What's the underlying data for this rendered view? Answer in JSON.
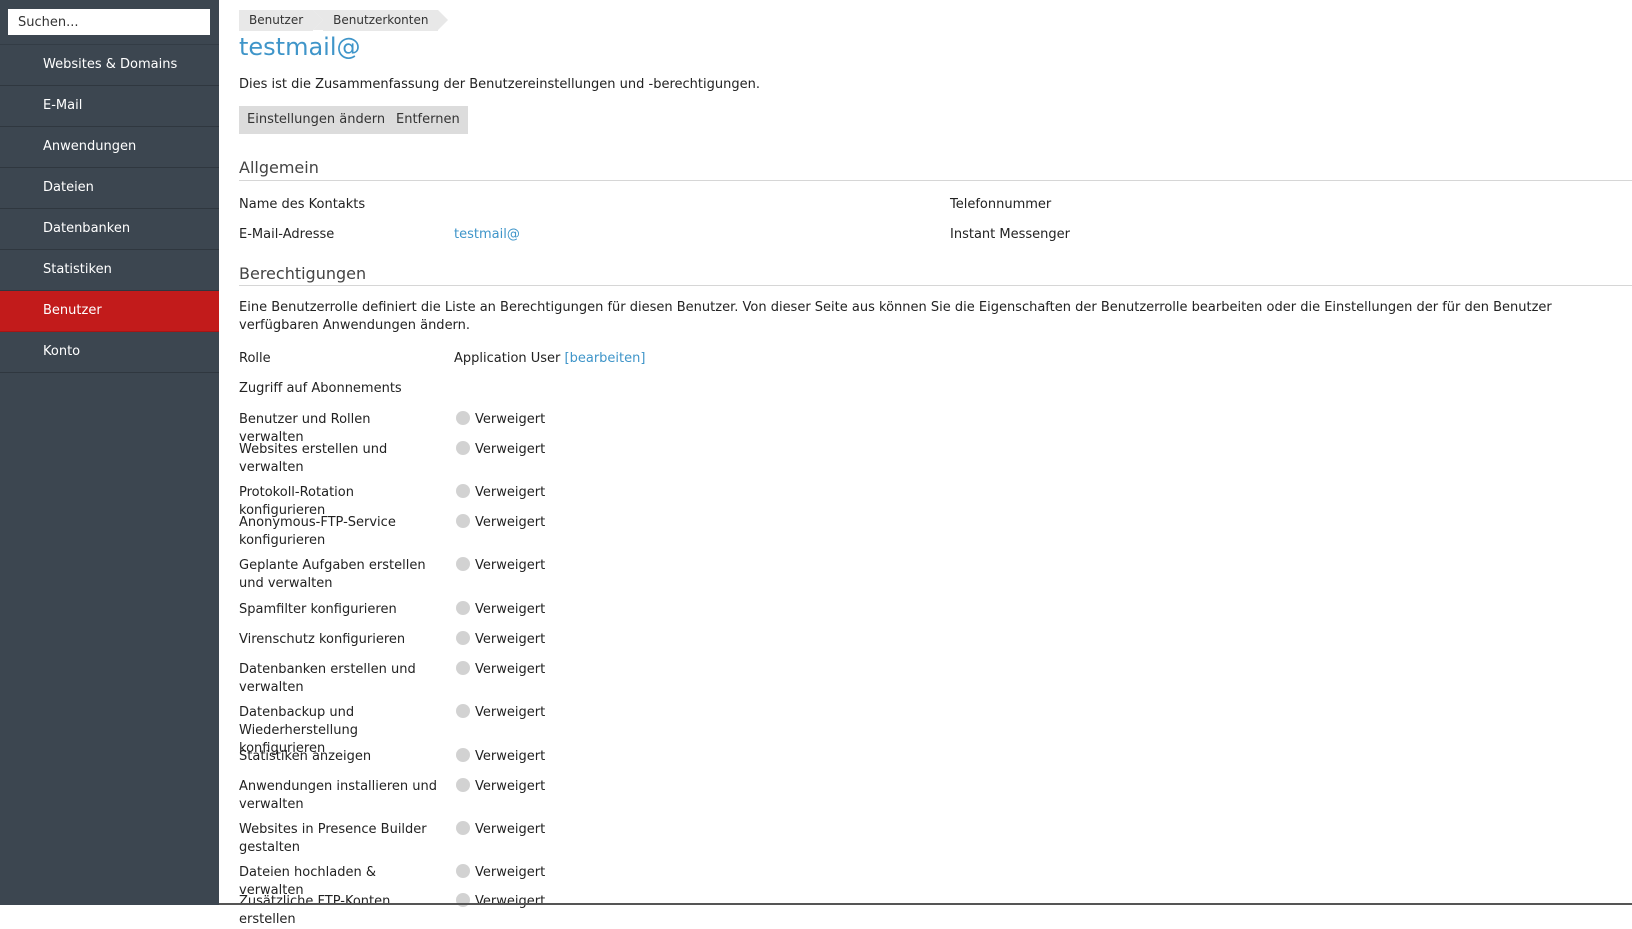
{
  "search": {
    "placeholder": "Suchen..."
  },
  "sidebar": {
    "items": [
      {
        "label": "Websites & Domains"
      },
      {
        "label": "E-Mail"
      },
      {
        "label": "Anwendungen"
      },
      {
        "label": "Dateien"
      },
      {
        "label": "Datenbanken"
      },
      {
        "label": "Statistiken"
      },
      {
        "label": "Benutzer",
        "active": true
      },
      {
        "label": "Konto"
      }
    ]
  },
  "breadcrumb": [
    "Benutzer",
    "Benutzerkonten"
  ],
  "page": {
    "title": "testmail@",
    "intro": "Dies ist die Zusammenfassung der Benutzereinstellungen und -berechtigungen.",
    "buttons": {
      "edit": "Einstellungen ändern",
      "remove": "Entfernen"
    }
  },
  "general": {
    "heading": "Allgemein",
    "contact_name_label": "Name des Kontakts",
    "phone_label": "Telefonnummer",
    "email_label": "E-Mail-Adresse",
    "email_value": "testmail@",
    "im_label": "Instant Messenger"
  },
  "permissions": {
    "heading": "Berechtigungen",
    "description": "Eine Benutzerrolle definiert die Liste an Berechtigungen für diesen Benutzer. Von dieser Seite aus können Sie die Eigenschaften der Benutzerrolle bearbeiten oder die Einstellungen der für den Benutzer verfügbaren Anwendungen ändern.",
    "role_label": "Rolle",
    "role_value": "Application User",
    "role_edit_link": "[bearbeiten]",
    "subscription_access_label": "Zugriff auf Abonnements",
    "status_denied": "Verweigert",
    "status_color": "#d2d2d2",
    "items": [
      {
        "name": "Benutzer und Rollen verwalten",
        "status": "Verweigert"
      },
      {
        "name": "Websites erstellen und verwalten",
        "status": "Verweigert"
      },
      {
        "name": "Protokoll-Rotation konfigurieren",
        "status": "Verweigert"
      },
      {
        "name": "Anonymous-FTP-Service konfigurieren",
        "status": "Verweigert"
      },
      {
        "name": "Geplante Aufgaben erstellen und verwalten",
        "status": "Verweigert"
      },
      {
        "name": "Spamfilter konfigurieren",
        "status": "Verweigert"
      },
      {
        "name": "Virenschutz konfigurieren",
        "status": "Verweigert"
      },
      {
        "name": "Datenbanken erstellen und verwalten",
        "status": "Verweigert"
      },
      {
        "name": "Datenbackup und Wiederherstellung konfigurieren",
        "status": "Verweigert"
      },
      {
        "name": "Statistiken anzeigen",
        "status": "Verweigert"
      },
      {
        "name": "Anwendungen installieren und verwalten",
        "status": "Verweigert"
      },
      {
        "name": "Websites in Presence Builder gestalten",
        "status": "Verweigert"
      },
      {
        "name": "Dateien hochladen & verwalten",
        "status": "Verweigert"
      },
      {
        "name": "Zusätzliche FTP-Konten erstellen",
        "status": "Verweigert"
      }
    ]
  },
  "colors": {
    "sidebar": "#3c4650",
    "active": "#c21b1b",
    "accent": "#3f95c9"
  }
}
